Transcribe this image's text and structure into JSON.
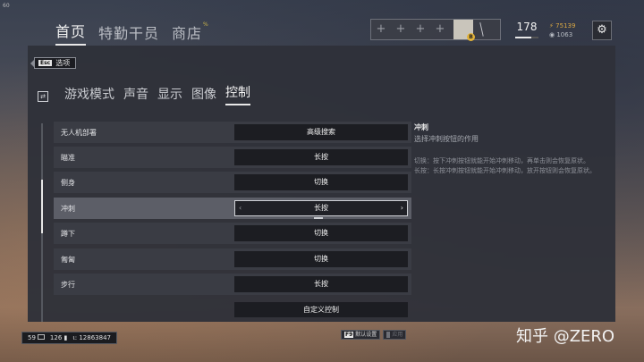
{
  "fps": "60",
  "topnav": {
    "items": [
      {
        "label": "首页",
        "active": true
      },
      {
        "label": "特勤干员",
        "active": false
      },
      {
        "label": "商店",
        "active": false
      }
    ],
    "shop_tag": "%"
  },
  "loadout": {
    "slots": [
      "+",
      "+",
      "+",
      "+"
    ],
    "operator_badge": "B",
    "knife_icon": "knife-icon"
  },
  "profile": {
    "level": "178",
    "level_progress": 0.7,
    "renown": "75139",
    "currency2": "1063"
  },
  "settings_icon": "gear-icon",
  "back": {
    "key": "Esc",
    "label": "选项"
  },
  "tabs": [
    {
      "label": "游戏模式",
      "active": false
    },
    {
      "label": "声音",
      "active": false
    },
    {
      "label": "显示",
      "active": false
    },
    {
      "label": "图像",
      "active": false
    },
    {
      "label": "控制",
      "active": true
    }
  ],
  "settings": [
    {
      "label": "无人机部署",
      "value": "高级搜索"
    },
    {
      "label": "瞄准",
      "value": "长按"
    },
    {
      "label": "侧身",
      "value": "切换"
    },
    {
      "label": "冲刺",
      "value": "长按",
      "selected": true
    },
    {
      "label": "蹲下",
      "value": "切换"
    },
    {
      "label": "匍匐",
      "value": "切换"
    },
    {
      "label": "步行",
      "value": "长按"
    }
  ],
  "custom_button": "自定义控制",
  "description": {
    "title": "冲刺",
    "subtitle": "选择冲刺按钮的作用",
    "line1": "切换：按下冲刺按钮就能开始冲刺移动，再单击则会恢复原状。",
    "line2": "长按：长按冲刺按钮就能开始冲刺移动，放开按钮则会恢复原状。"
  },
  "status": {
    "fps": "59",
    "ping": "126",
    "id": "12863847"
  },
  "footer": {
    "default_key": "F9",
    "default_label": "默认设置",
    "apply_label": "应用"
  },
  "watermark": "知乎 @ZERO"
}
